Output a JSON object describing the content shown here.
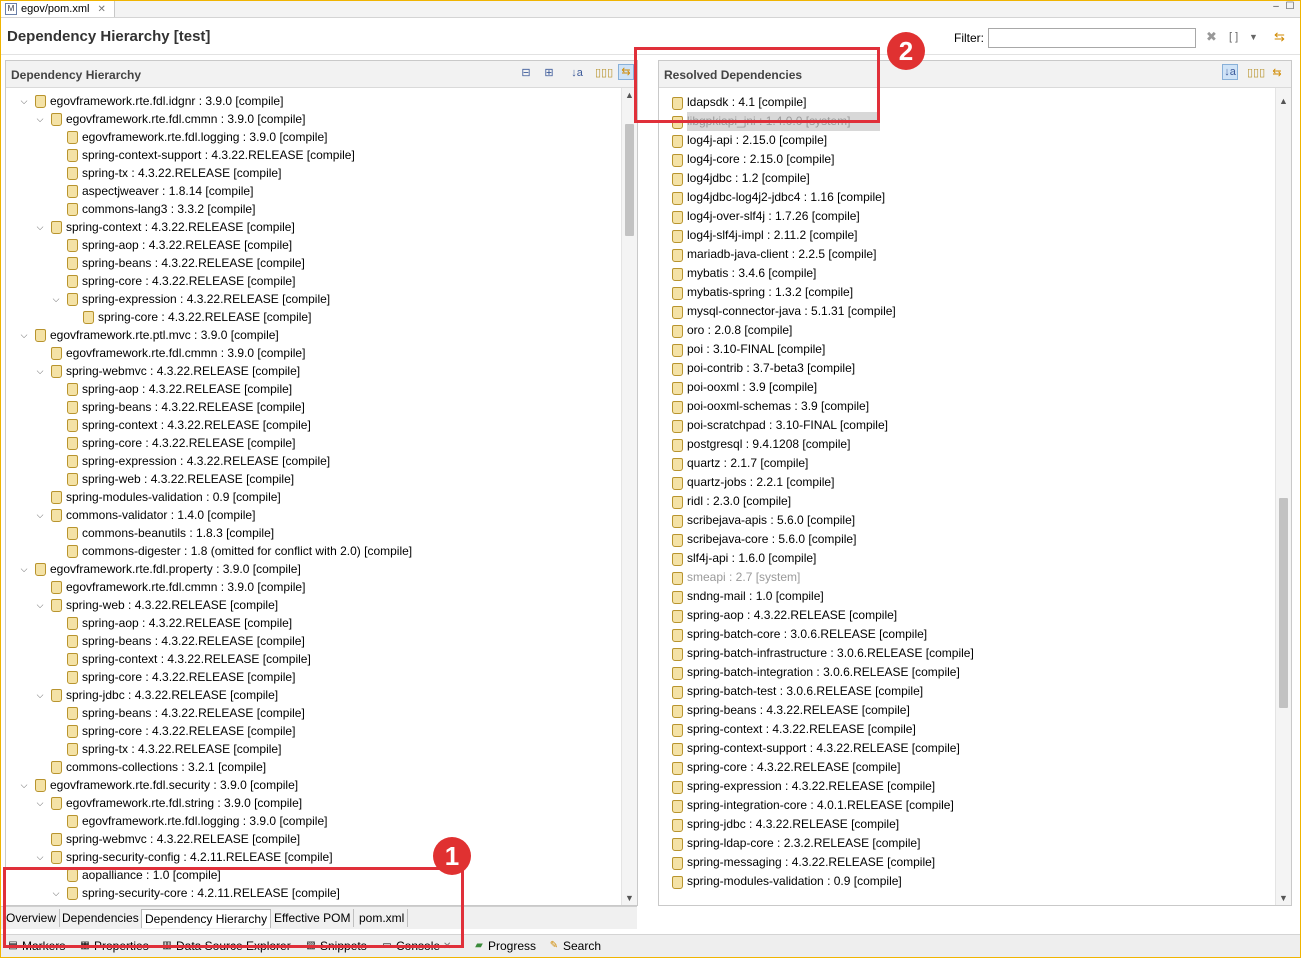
{
  "editor_tab": {
    "label": "egov/pom.xml",
    "icon": "maven-file-icon"
  },
  "header": {
    "title": "Dependency Hierarchy [test]",
    "filter_label": "Filter:",
    "filter_value": ""
  },
  "left_pane": {
    "title": "Dependency Hierarchy"
  },
  "right_pane": {
    "title": "Resolved Dependencies"
  },
  "hierarchy": [
    {
      "depth": 0,
      "expand": "v",
      "label": "egovframework.rte.fdl.idgnr : 3.9.0 [compile]"
    },
    {
      "depth": 1,
      "expand": "v",
      "label": "egovframework.rte.fdl.cmmn : 3.9.0 [compile]"
    },
    {
      "depth": 2,
      "expand": "",
      "label": "egovframework.rte.fdl.logging : 3.9.0 [compile]"
    },
    {
      "depth": 2,
      "expand": "",
      "label": "spring-context-support : 4.3.22.RELEASE [compile]"
    },
    {
      "depth": 2,
      "expand": "",
      "label": "spring-tx : 4.3.22.RELEASE [compile]"
    },
    {
      "depth": 2,
      "expand": "",
      "label": "aspectjweaver : 1.8.14 [compile]"
    },
    {
      "depth": 2,
      "expand": "",
      "label": "commons-lang3 : 3.3.2 [compile]"
    },
    {
      "depth": 1,
      "expand": "v",
      "label": "spring-context : 4.3.22.RELEASE [compile]"
    },
    {
      "depth": 2,
      "expand": "",
      "label": "spring-aop : 4.3.22.RELEASE [compile]"
    },
    {
      "depth": 2,
      "expand": "",
      "label": "spring-beans : 4.3.22.RELEASE [compile]"
    },
    {
      "depth": 2,
      "expand": "",
      "label": "spring-core : 4.3.22.RELEASE [compile]"
    },
    {
      "depth": 2,
      "expand": "v",
      "label": "spring-expression : 4.3.22.RELEASE [compile]"
    },
    {
      "depth": 3,
      "expand": "",
      "label": "spring-core : 4.3.22.RELEASE [compile]"
    },
    {
      "depth": 0,
      "expand": "v",
      "label": "egovframework.rte.ptl.mvc : 3.9.0 [compile]"
    },
    {
      "depth": 1,
      "expand": "",
      "label": "egovframework.rte.fdl.cmmn : 3.9.0 [compile]"
    },
    {
      "depth": 1,
      "expand": "v",
      "label": "spring-webmvc : 4.3.22.RELEASE [compile]"
    },
    {
      "depth": 2,
      "expand": "",
      "label": "spring-aop : 4.3.22.RELEASE [compile]"
    },
    {
      "depth": 2,
      "expand": "",
      "label": "spring-beans : 4.3.22.RELEASE [compile]"
    },
    {
      "depth": 2,
      "expand": "",
      "label": "spring-context : 4.3.22.RELEASE [compile]"
    },
    {
      "depth": 2,
      "expand": "",
      "label": "spring-core : 4.3.22.RELEASE [compile]"
    },
    {
      "depth": 2,
      "expand": "",
      "label": "spring-expression : 4.3.22.RELEASE [compile]"
    },
    {
      "depth": 2,
      "expand": "",
      "label": "spring-web : 4.3.22.RELEASE [compile]"
    },
    {
      "depth": 1,
      "expand": "",
      "label": "spring-modules-validation : 0.9 [compile]"
    },
    {
      "depth": 1,
      "expand": "v",
      "label": "commons-validator : 1.4.0 [compile]"
    },
    {
      "depth": 2,
      "expand": "",
      "label": "commons-beanutils : 1.8.3 [compile]"
    },
    {
      "depth": 2,
      "expand": "",
      "label": "commons-digester : 1.8 (omitted for conflict with 2.0) [compile]"
    },
    {
      "depth": 0,
      "expand": "v",
      "label": "egovframework.rte.fdl.property : 3.9.0 [compile]"
    },
    {
      "depth": 1,
      "expand": "",
      "label": "egovframework.rte.fdl.cmmn : 3.9.0 [compile]"
    },
    {
      "depth": 1,
      "expand": "v",
      "label": "spring-web : 4.3.22.RELEASE [compile]"
    },
    {
      "depth": 2,
      "expand": "",
      "label": "spring-aop : 4.3.22.RELEASE [compile]"
    },
    {
      "depth": 2,
      "expand": "",
      "label": "spring-beans : 4.3.22.RELEASE [compile]"
    },
    {
      "depth": 2,
      "expand": "",
      "label": "spring-context : 4.3.22.RELEASE [compile]"
    },
    {
      "depth": 2,
      "expand": "",
      "label": "spring-core : 4.3.22.RELEASE [compile]"
    },
    {
      "depth": 1,
      "expand": "v",
      "label": "spring-jdbc : 4.3.22.RELEASE [compile]"
    },
    {
      "depth": 2,
      "expand": "",
      "label": "spring-beans : 4.3.22.RELEASE [compile]"
    },
    {
      "depth": 2,
      "expand": "",
      "label": "spring-core : 4.3.22.RELEASE [compile]"
    },
    {
      "depth": 2,
      "expand": "",
      "label": "spring-tx : 4.3.22.RELEASE [compile]"
    },
    {
      "depth": 1,
      "expand": "",
      "label": "commons-collections : 3.2.1 [compile]"
    },
    {
      "depth": 0,
      "expand": "v",
      "label": "egovframework.rte.fdl.security : 3.9.0 [compile]"
    },
    {
      "depth": 1,
      "expand": "v",
      "label": "egovframework.rte.fdl.string : 3.9.0 [compile]"
    },
    {
      "depth": 2,
      "expand": "",
      "label": "egovframework.rte.fdl.logging : 3.9.0 [compile]"
    },
    {
      "depth": 1,
      "expand": "",
      "label": "spring-webmvc : 4.3.22.RELEASE [compile]"
    },
    {
      "depth": 1,
      "expand": "v",
      "label": "spring-security-config : 4.2.11.RELEASE [compile]"
    },
    {
      "depth": 2,
      "expand": "",
      "label": "aopalliance : 1.0 [compile]"
    },
    {
      "depth": 2,
      "expand": "v",
      "label": "spring-security-core : 4.2.11.RELEASE [compile]"
    }
  ],
  "resolved": [
    {
      "label": "ldapsdk : 4.1 [compile]",
      "grey": false
    },
    {
      "label": "libgpkiapi_jni : 1.4.0.0 [system]",
      "grey": true,
      "highlight": true
    },
    {
      "label": "log4j-api : 2.15.0 [compile]",
      "grey": false
    },
    {
      "label": "log4j-core : 2.15.0 [compile]",
      "grey": false
    },
    {
      "label": "log4jdbc : 1.2 [compile]",
      "grey": false
    },
    {
      "label": "log4jdbc-log4j2-jdbc4 : 1.16 [compile]",
      "grey": false
    },
    {
      "label": "log4j-over-slf4j : 1.7.26 [compile]",
      "grey": false
    },
    {
      "label": "log4j-slf4j-impl : 2.11.2 [compile]",
      "grey": false
    },
    {
      "label": "mariadb-java-client : 2.2.5 [compile]",
      "grey": false
    },
    {
      "label": "mybatis : 3.4.6 [compile]",
      "grey": false
    },
    {
      "label": "mybatis-spring : 1.3.2 [compile]",
      "grey": false
    },
    {
      "label": "mysql-connector-java : 5.1.31 [compile]",
      "grey": false
    },
    {
      "label": "oro : 2.0.8 [compile]",
      "grey": false
    },
    {
      "label": "poi : 3.10-FINAL [compile]",
      "grey": false
    },
    {
      "label": "poi-contrib : 3.7-beta3 [compile]",
      "grey": false
    },
    {
      "label": "poi-ooxml : 3.9 [compile]",
      "grey": false
    },
    {
      "label": "poi-ooxml-schemas : 3.9 [compile]",
      "grey": false
    },
    {
      "label": "poi-scratchpad : 3.10-FINAL [compile]",
      "grey": false
    },
    {
      "label": "postgresql : 9.4.1208 [compile]",
      "grey": false
    },
    {
      "label": "quartz : 2.1.7 [compile]",
      "grey": false
    },
    {
      "label": "quartz-jobs : 2.2.1 [compile]",
      "grey": false
    },
    {
      "label": "ridl : 2.3.0 [compile]",
      "grey": false
    },
    {
      "label": "scribejava-apis : 5.6.0 [compile]",
      "grey": false
    },
    {
      "label": "scribejava-core : 5.6.0 [compile]",
      "grey": false
    },
    {
      "label": "slf4j-api : 1.6.0 [compile]",
      "grey": false
    },
    {
      "label": "smeapi : 2.7 [system]",
      "grey": true
    },
    {
      "label": "sndng-mail : 1.0 [compile]",
      "grey": false
    },
    {
      "label": "spring-aop : 4.3.22.RELEASE [compile]",
      "grey": false
    },
    {
      "label": "spring-batch-core : 3.0.6.RELEASE [compile]",
      "grey": false
    },
    {
      "label": "spring-batch-infrastructure : 3.0.6.RELEASE [compile]",
      "grey": false
    },
    {
      "label": "spring-batch-integration : 3.0.6.RELEASE [compile]",
      "grey": false
    },
    {
      "label": "spring-batch-test : 3.0.6.RELEASE [compile]",
      "grey": false
    },
    {
      "label": "spring-beans : 4.3.22.RELEASE [compile]",
      "grey": false
    },
    {
      "label": "spring-context : 4.3.22.RELEASE [compile]",
      "grey": false
    },
    {
      "label": "spring-context-support : 4.3.22.RELEASE [compile]",
      "grey": false
    },
    {
      "label": "spring-core : 4.3.22.RELEASE [compile]",
      "grey": false
    },
    {
      "label": "spring-expression : 4.3.22.RELEASE [compile]",
      "grey": false
    },
    {
      "label": "spring-integration-core : 4.0.1.RELEASE [compile]",
      "grey": false
    },
    {
      "label": "spring-jdbc : 4.3.22.RELEASE [compile]",
      "grey": false
    },
    {
      "label": "spring-ldap-core : 2.3.2.RELEASE [compile]",
      "grey": false
    },
    {
      "label": "spring-messaging : 4.3.22.RELEASE [compile]",
      "grey": false
    },
    {
      "label": "spring-modules-validation : 0.9 [compile]",
      "grey": false
    }
  ],
  "bottom_tabs": [
    {
      "label": "Overview",
      "active": false
    },
    {
      "label": "Dependencies",
      "active": false
    },
    {
      "label": "Dependency Hierarchy",
      "active": true
    },
    {
      "label": "Effective POM",
      "active": false
    },
    {
      "label": "pom.xml",
      "active": false
    }
  ],
  "view_tabs": [
    {
      "label": "Markers",
      "icon": "markers-icon"
    },
    {
      "label": "Properties",
      "icon": "properties-icon"
    },
    {
      "label": "Data Source Explorer",
      "icon": "data-source-icon"
    },
    {
      "label": "Snippets",
      "icon": "snippets-icon"
    },
    {
      "label": "Console",
      "icon": "console-icon"
    },
    {
      "label": "Progress",
      "icon": "progress-icon"
    },
    {
      "label": "Search",
      "icon": "search-icon"
    }
  ],
  "callouts": [
    {
      "number": "1"
    },
    {
      "number": "2"
    }
  ],
  "colors": {
    "callout": "#e03131",
    "jar": "#f4e2a6",
    "accent": "#3d5b9a"
  }
}
